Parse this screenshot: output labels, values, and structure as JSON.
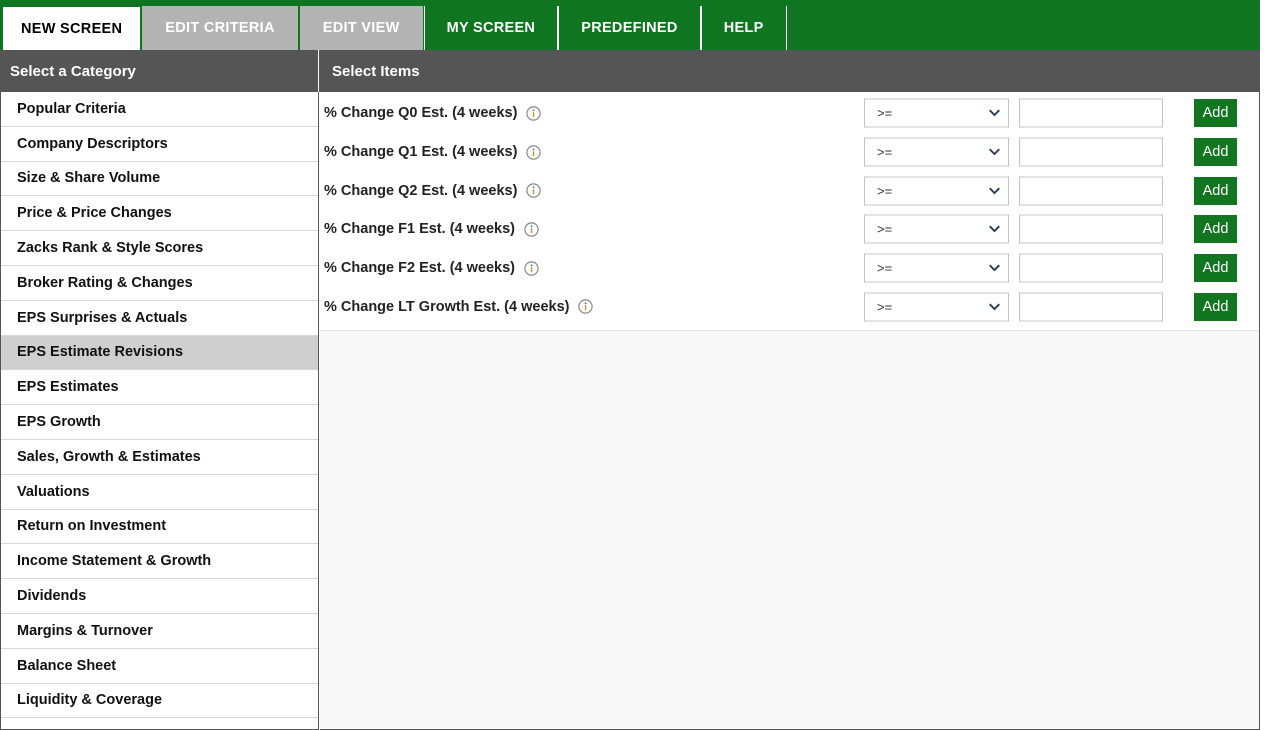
{
  "tabs": [
    {
      "label": "NEW SCREEN",
      "state": "active"
    },
    {
      "label": "EDIT CRITERIA",
      "state": "disabled"
    },
    {
      "label": "EDIT VIEW",
      "state": "disabled"
    },
    {
      "label": "MY SCREEN",
      "state": "green"
    },
    {
      "label": "PREDEFINED",
      "state": "green"
    },
    {
      "label": "HELP",
      "state": "green"
    }
  ],
  "headers": {
    "category": "Select a Category",
    "items": "Select Items"
  },
  "categories": [
    {
      "label": "Popular Criteria",
      "selected": false
    },
    {
      "label": "Company Descriptors",
      "selected": false
    },
    {
      "label": "Size & Share Volume",
      "selected": false
    },
    {
      "label": "Price & Price Changes",
      "selected": false
    },
    {
      "label": "Zacks Rank & Style Scores",
      "selected": false
    },
    {
      "label": "Broker Rating & Changes",
      "selected": false
    },
    {
      "label": "EPS Surprises & Actuals",
      "selected": false
    },
    {
      "label": "EPS Estimate Revisions",
      "selected": true
    },
    {
      "label": "EPS Estimates",
      "selected": false
    },
    {
      "label": "EPS Growth",
      "selected": false
    },
    {
      "label": "Sales, Growth & Estimates",
      "selected": false
    },
    {
      "label": "Valuations",
      "selected": false
    },
    {
      "label": "Return on Investment",
      "selected": false
    },
    {
      "label": "Income Statement & Growth",
      "selected": false
    },
    {
      "label": "Dividends",
      "selected": false
    },
    {
      "label": "Margins & Turnover",
      "selected": false
    },
    {
      "label": "Balance Sheet",
      "selected": false
    },
    {
      "label": "Liquidity & Coverage",
      "selected": false
    }
  ],
  "items": [
    {
      "label": "% Change Q0 Est. (4 weeks)",
      "operator": ">=",
      "value": "",
      "placeholder": "",
      "add_label": "Add"
    },
    {
      "label": "% Change Q1 Est. (4 weeks)",
      "operator": ">=",
      "value": "",
      "placeholder": "",
      "add_label": "Add"
    },
    {
      "label": "% Change Q2 Est. (4 weeks)",
      "operator": ">=",
      "value": "",
      "placeholder": "",
      "add_label": "Add"
    },
    {
      "label": "% Change F1 Est. (4 weeks)",
      "operator": ">=",
      "value": "",
      "placeholder": "",
      "add_label": "Add"
    },
    {
      "label": "% Change F2 Est. (4 weeks)",
      "operator": ">=",
      "value": "",
      "placeholder": "",
      "add_label": "Add"
    },
    {
      "label": "% Change LT Growth Est. (4 weeks)",
      "operator": ">=",
      "value": "",
      "placeholder": "",
      "add_label": "Add"
    }
  ],
  "icons": {
    "info": "info-icon",
    "chevron": "chevron-down-icon"
  },
  "colors": {
    "brand_green": "#0f7521",
    "button_green": "#11761f",
    "header_gray": "#555555",
    "tab_disabled_gray": "#b3b3b3",
    "selected_row_gray": "#cfcfcf",
    "content_bg": "#f8f8f8"
  }
}
